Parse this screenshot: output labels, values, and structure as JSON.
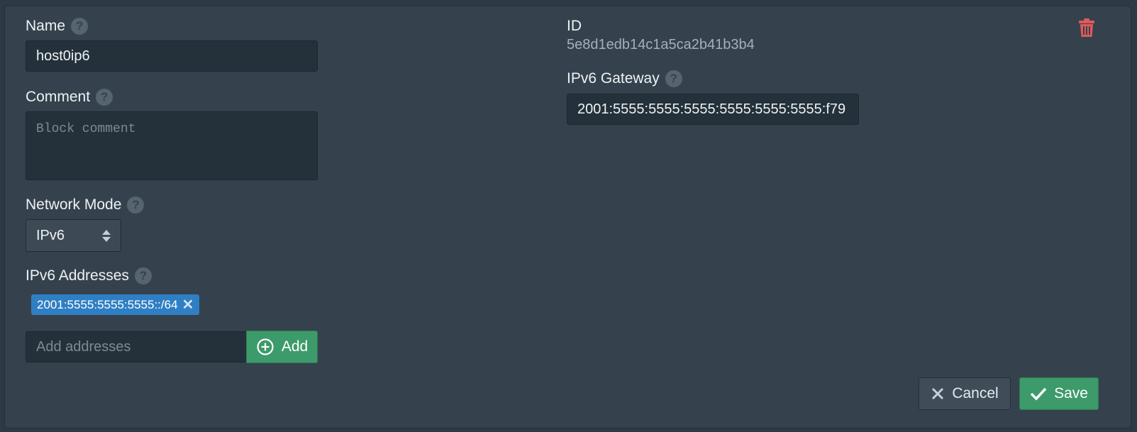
{
  "form": {
    "name": {
      "label": "Name",
      "value": "host0ip6"
    },
    "comment": {
      "label": "Comment",
      "placeholder": "Block comment"
    },
    "network_mode": {
      "label": "Network Mode",
      "selected": "IPv6"
    },
    "ipv6_addresses": {
      "label": "IPv6 Addresses",
      "items": [
        "2001:5555:5555:5555::/64"
      ],
      "placeholder": "Add addresses",
      "add_label": "Add"
    },
    "id": {
      "label": "ID",
      "value": "5e8d1edb14c1a5ca2b41b3b4"
    },
    "ipv6_gateway": {
      "label": "IPv6 Gateway",
      "value": "2001:5555:5555:5555:5555:5555:5555:f79"
    }
  },
  "actions": {
    "cancel_label": "Cancel",
    "save_label": "Save"
  },
  "icons": {
    "help": "?",
    "remove": "✕",
    "delete": "trash-icon",
    "add": "plus-circle-icon",
    "cancel": "x-icon",
    "save": "check-icon"
  },
  "colors": {
    "accent_green": "#3d9a6a",
    "chip_blue": "#2f7fc4",
    "delete_red": "#e05a5a"
  }
}
